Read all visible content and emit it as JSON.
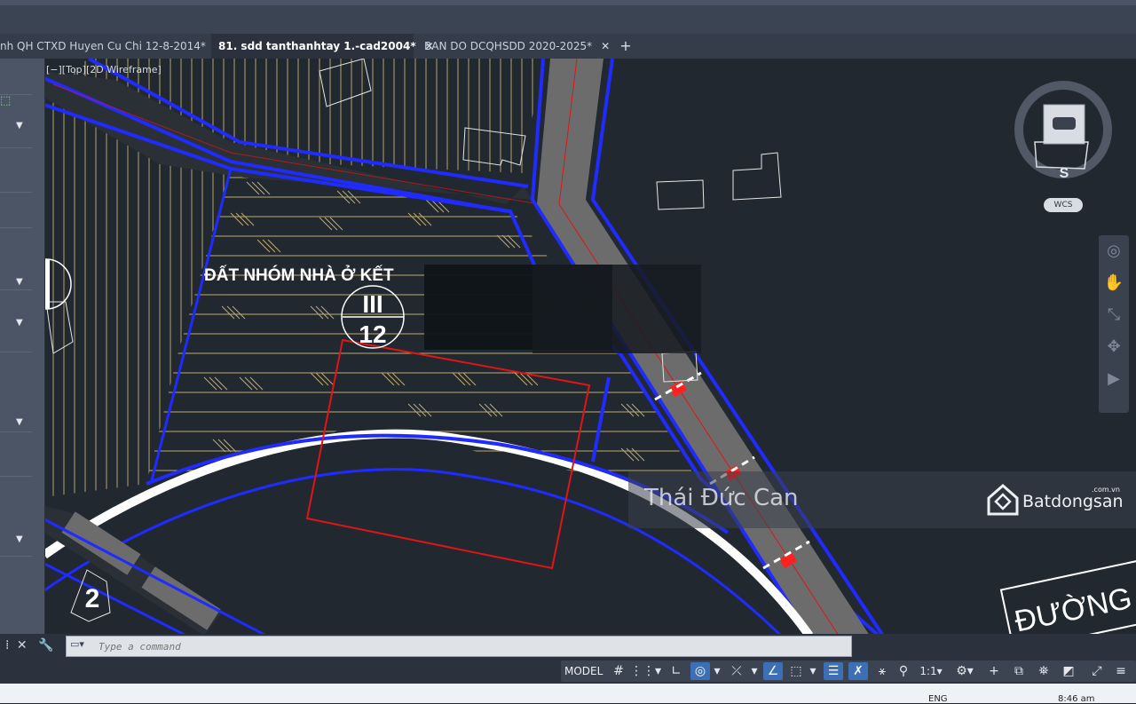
{
  "tabs": [
    {
      "label": "nh QH CTXD Huyen Cu Chi 12-8-2014*",
      "active": false
    },
    {
      "label": "81. sdd tanthanhtay 1.-cad2004*",
      "active": true
    },
    {
      "label": "BAN DO DCQHSDD 2020-2025*",
      "active": false
    }
  ],
  "viewport": {
    "view_label": "[−][Top][2D Wireframe]",
    "drawing_text_1": "ĐẤT NHÓM NHÀ Ở KẾT",
    "zone_code": "III",
    "zone_number": "12",
    "road_label": "ĐƯỜNG",
    "side_number": "2",
    "compass_direction": "S",
    "ucs_label": "WCS"
  },
  "watermark": {
    "name": "Thái Đức Can",
    "brand": "Batdongsan",
    "brand_domain": ".com.vn"
  },
  "command_line": {
    "placeholder": "Type a command"
  },
  "status_bar": {
    "model_label": "MODEL",
    "scale": "1:1"
  },
  "taskbar": {
    "language": "ENG",
    "time": "8:46 am"
  },
  "colors": {
    "canvas": "#212830",
    "boundary_blue": "#1f2bff",
    "parcel_red": "#e01515",
    "hatch_yellow": "#d9c27a",
    "road_gray": "#6c6c6c",
    "ui_panel": "#2b323d"
  }
}
